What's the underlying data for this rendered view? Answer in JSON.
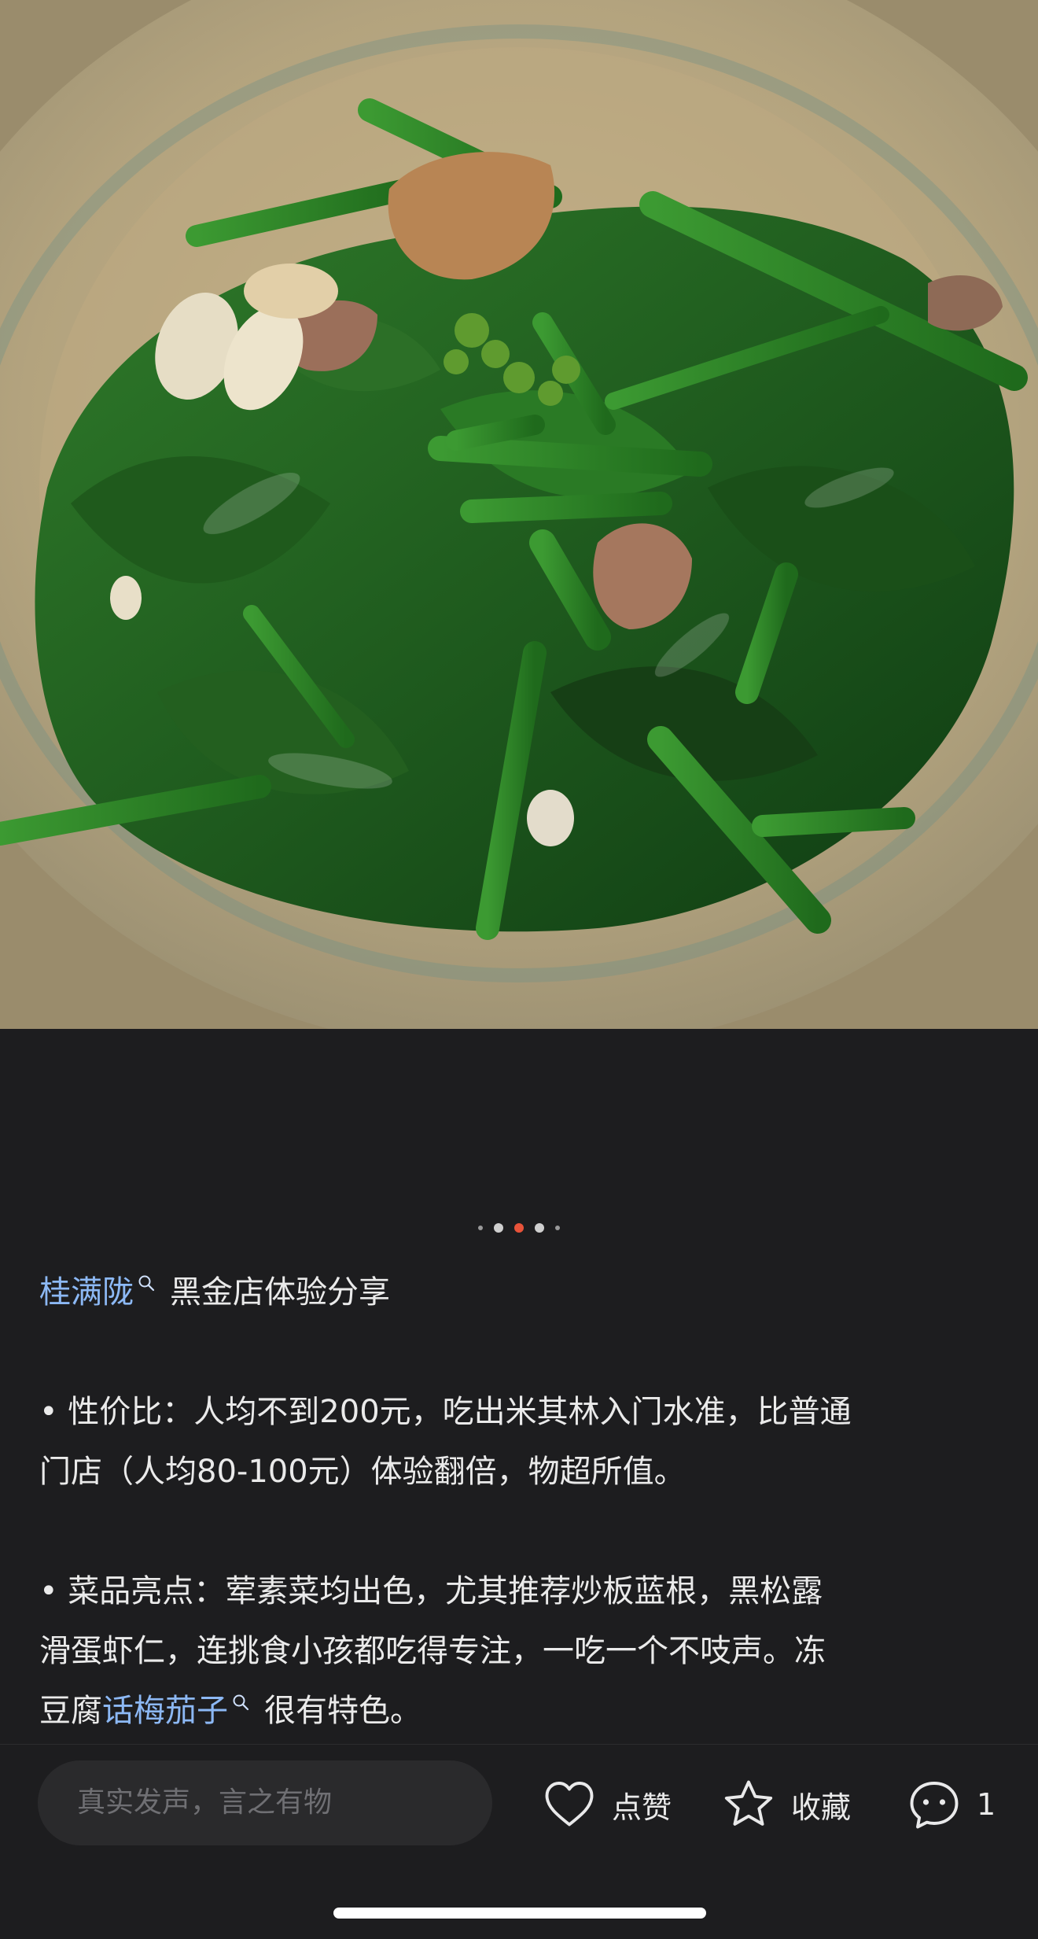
{
  "post": {
    "image_alt": "Stir-fried greens with garlic and pork in a ceramic plate",
    "carousel": {
      "count": 5,
      "active_index": 2
    },
    "title_link": "桂满陇",
    "title_text": "黑金店体验分享",
    "paragraph1": {
      "lines": [
        "• 性价比：人均不到200元，吃出米其林入门水准，比普通",
        "门店（人均80-100元）体验翻倍，物超所值。"
      ]
    },
    "paragraph2": {
      "lines": [
        "• 菜品亮点：荤素菜均出色，尤其推荐炒板蓝根，黑松露",
        "滑蛋虾仁，连挑食小孩都吃得专注，一吃一个不吱声。冻"
      ],
      "last_line_prefix": "豆腐",
      "last_line_link": "话梅茄子",
      "last_line_suffix": "很有特色。"
    }
  },
  "bottom_bar": {
    "comment_placeholder": "真实发声，言之有物",
    "like_label": "点赞",
    "favorite_label": "收藏",
    "comment_count": "1"
  },
  "colors": {
    "link": "#8cb8f4",
    "active_dot": "#e8533a",
    "background": "#1d1d1f"
  }
}
